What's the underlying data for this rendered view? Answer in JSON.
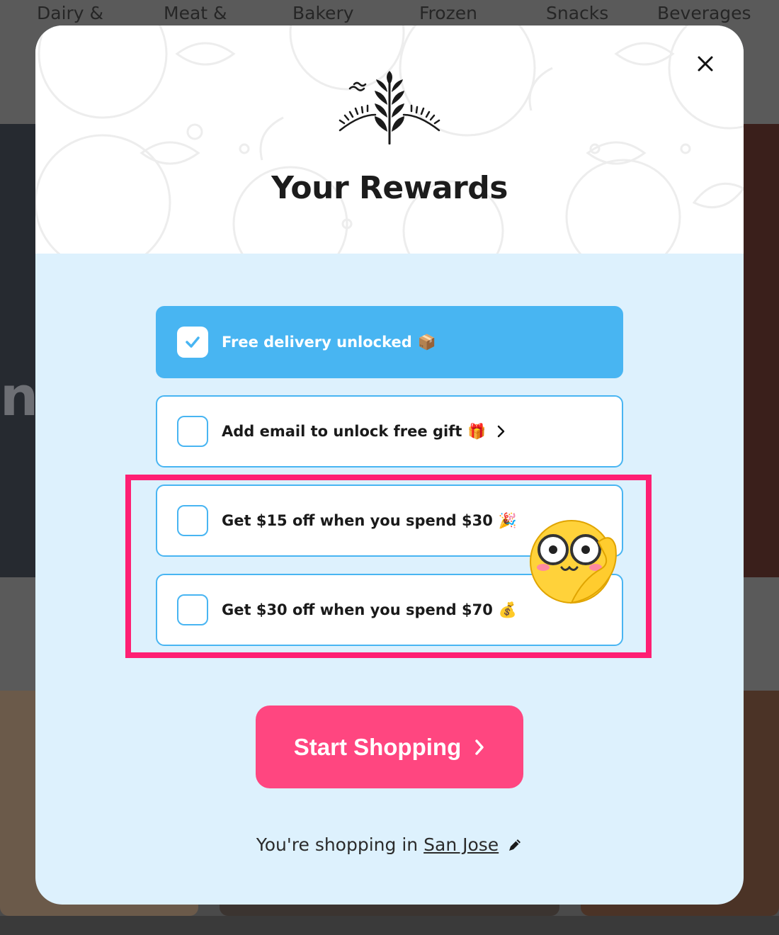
{
  "background_nav": {
    "items": [
      "Dairy &",
      "Meat &",
      "Bakery",
      "Frozen",
      "Snacks",
      "Beverages"
    ]
  },
  "background_hero": {
    "fragment": "ne"
  },
  "modal": {
    "title": "Your Rewards",
    "close_icon": "close-icon",
    "logo_icon": "wheat-logo-icon",
    "rewards": [
      {
        "label": "Free delivery unlocked",
        "emoji": "📦",
        "checked": true,
        "has_chevron": false
      },
      {
        "label": "Add email to unlock free gift",
        "emoji": "🎁",
        "checked": false,
        "has_chevron": true
      },
      {
        "label": "Get $15 off when you spend $30",
        "emoji": "🎉",
        "checked": false,
        "has_chevron": false
      },
      {
        "label": "Get $30 off when you spend $70",
        "emoji": "💰",
        "checked": false,
        "has_chevron": false
      }
    ],
    "cta": {
      "label": "Start Shopping"
    },
    "location": {
      "prefix": "You're shopping in",
      "city": "San Jose",
      "edit_icon": "pencil-icon"
    }
  },
  "colors": {
    "accent_blue": "#48b5f2",
    "panel_bg": "#ddf1fd",
    "cta_pink": "#ff4680",
    "highlight_pink": "#ff1f73"
  }
}
